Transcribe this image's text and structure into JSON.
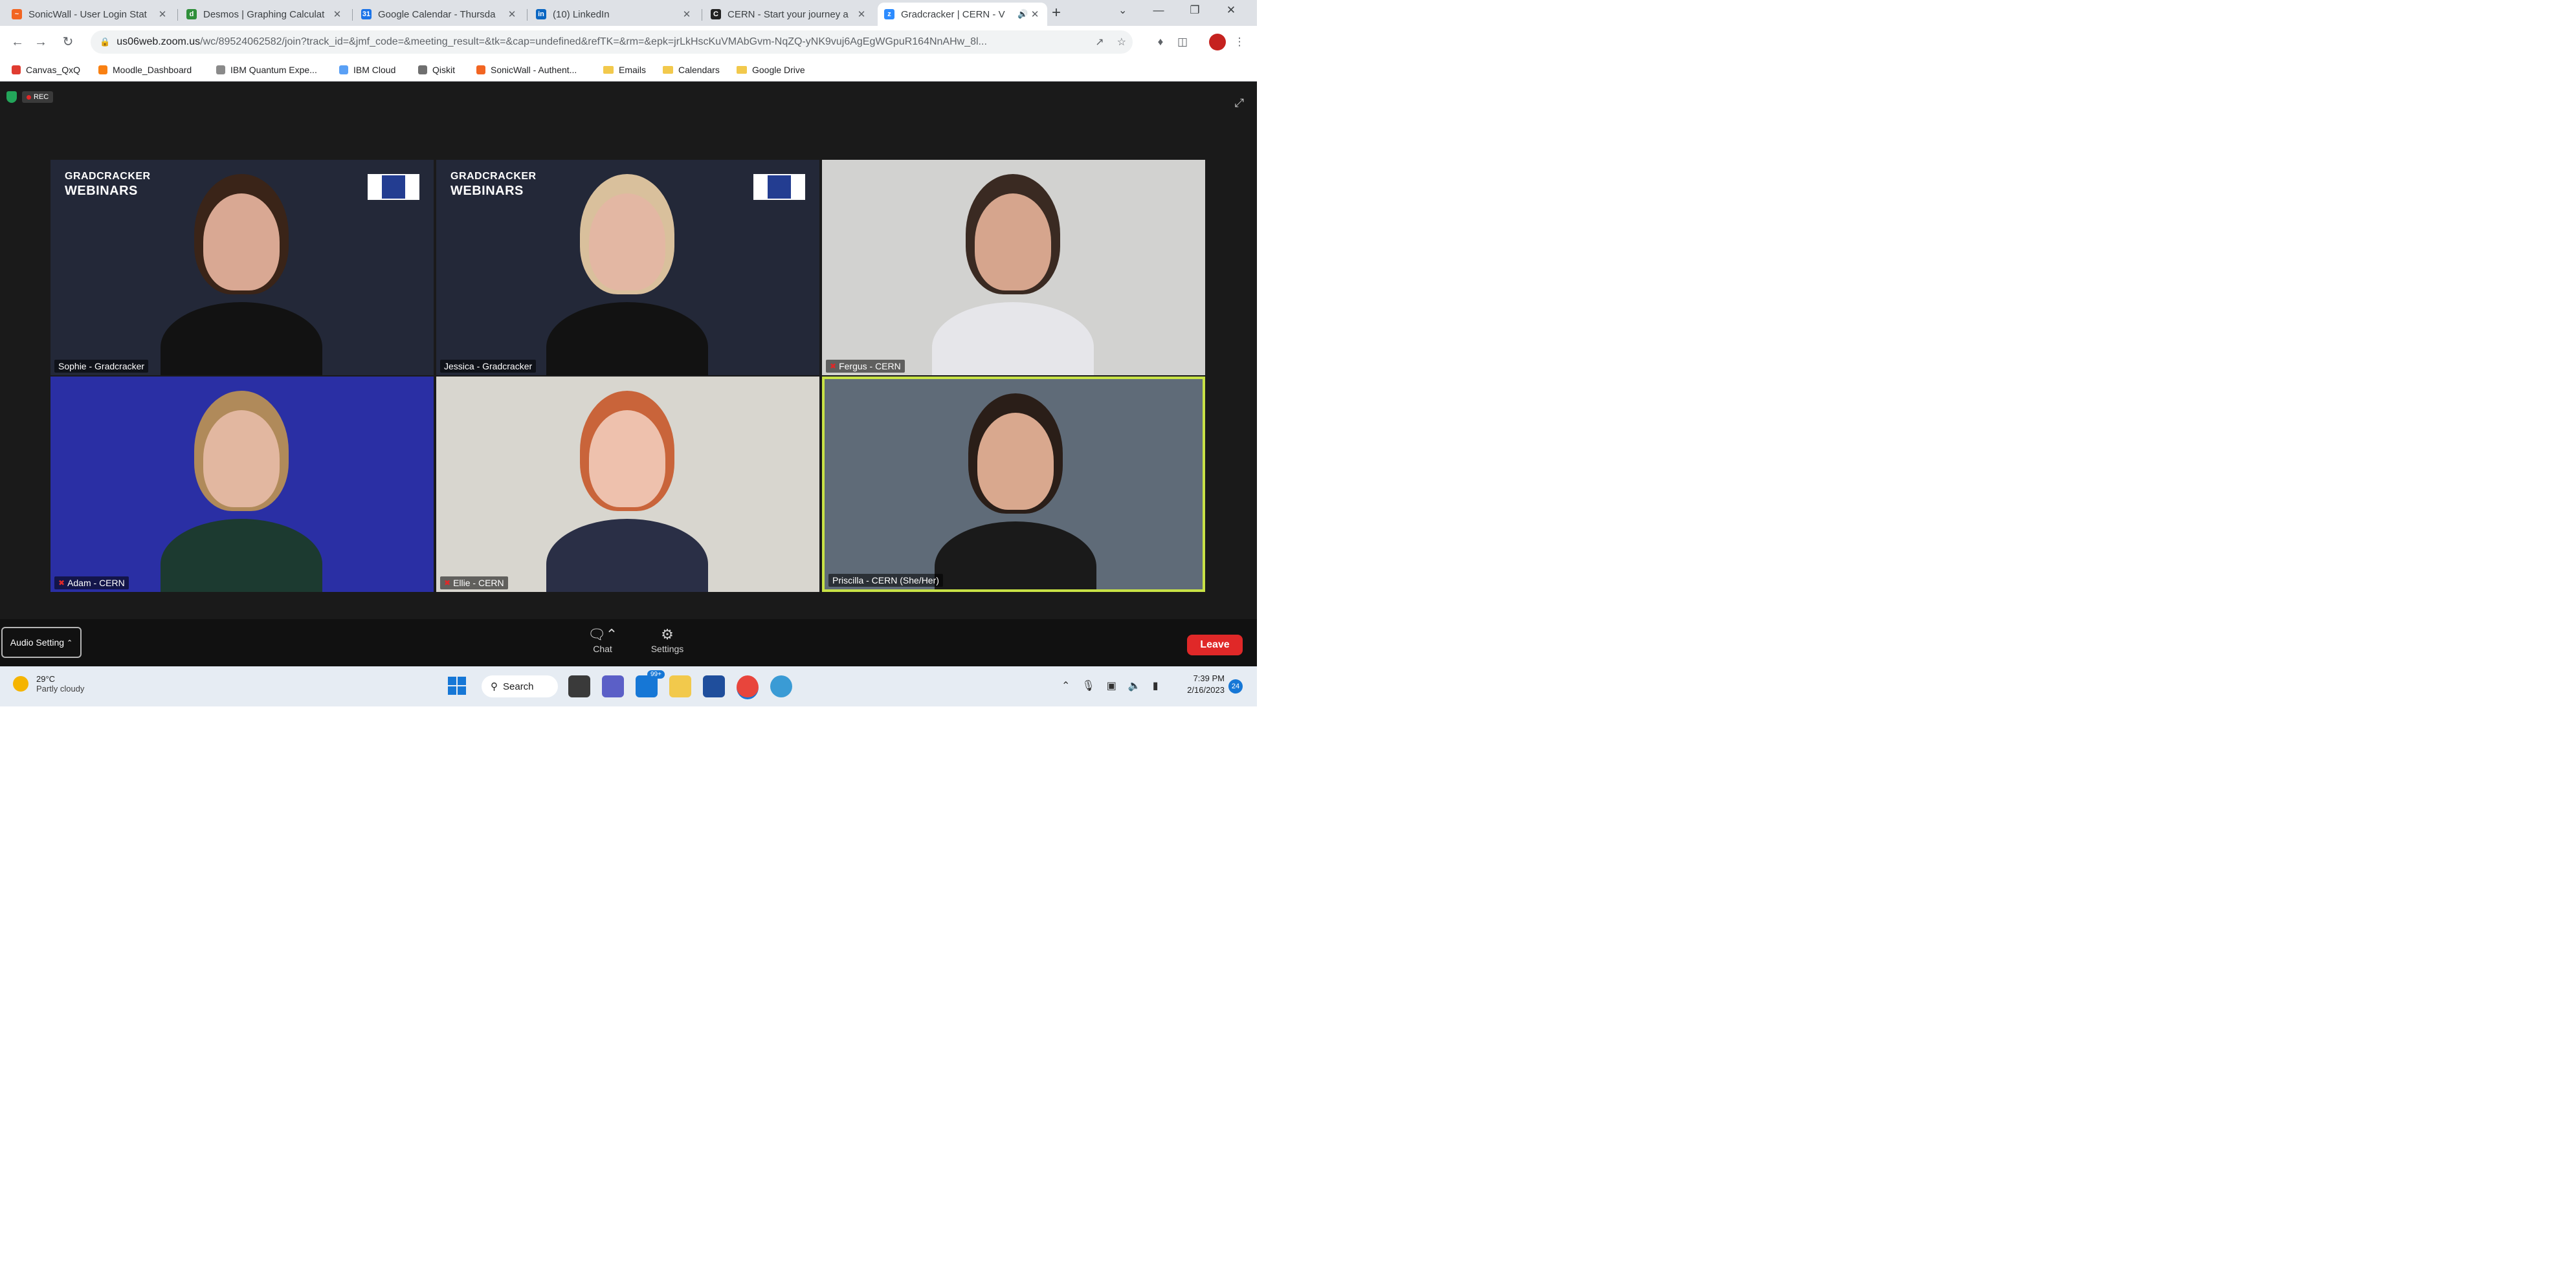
{
  "browser": {
    "tabs": [
      {
        "title": "SonicWall - User Login Stat",
        "favicon_color": "#f26522",
        "favicon_glyph": "~"
      },
      {
        "title": "Desmos | Graphing Calculat",
        "favicon_color": "#2f8f3a",
        "favicon_glyph": "d"
      },
      {
        "title": "Google Calendar - Thursda",
        "favicon_color": "#1a73e8",
        "favicon_glyph": "31"
      },
      {
        "title": "(10) LinkedIn",
        "favicon_color": "#0a66c2",
        "favicon_glyph": "in"
      },
      {
        "title": "CERN - Start your journey a",
        "favicon_color": "#222222",
        "favicon_glyph": "C"
      },
      {
        "title": "Gradcracker | CERN - V",
        "favicon_color": "#2d8cff",
        "favicon_glyph": "z",
        "active": true
      }
    ],
    "new_tab_label": "+",
    "url_host": "us06web.zoom.us",
    "url_rest": "/wc/89524062582/join?track_id=&jmf_code=&meeting_result=&tk=&cap=undefined&refTK=&rm=&epk=jrLkHscKuVMAbGvm-NqZQ-yNK9vuj6AgEgWGpuR164NnAHw_8l...",
    "bookmarks": [
      {
        "label": "Canvas_QxQ",
        "icon": "canvas-icon",
        "color": "#e03c31"
      },
      {
        "label": "Moodle_Dashboard",
        "icon": "moodle-icon",
        "color": "#f98012"
      },
      {
        "label": "IBM Quantum Expe...",
        "icon": "ibm-quantum-icon",
        "color": "#8a8a8a"
      },
      {
        "label": "IBM Cloud",
        "icon": "ibm-cloud-icon",
        "color": "#5aa0f5"
      },
      {
        "label": "Qiskit",
        "icon": "qiskit-icon",
        "color": "#6f6f6f"
      },
      {
        "label": "SonicWall - Authent...",
        "icon": "sonicwall-icon",
        "color": "#f26522"
      },
      {
        "label": "Emails",
        "icon": "folder-icon",
        "color": "#f2c94c"
      },
      {
        "label": "Calendars",
        "icon": "folder-icon",
        "color": "#f2c94c"
      },
      {
        "label": "Google Drive",
        "icon": "folder-icon",
        "color": "#f2c94c"
      }
    ]
  },
  "meeting": {
    "rec_label": "REC",
    "participants": [
      {
        "name": "Sophie - Gradcracker",
        "muted": false,
        "brand_line1": "GRADCRACKER",
        "brand_line2": "WEBINARS",
        "bg": "#232838",
        "skin": "#d9a893",
        "hair": "#3a2418",
        "shirt": "#121212"
      },
      {
        "name": "Jessica - Gradcracker",
        "muted": false,
        "brand_line1": "GRADCRACKER",
        "brand_line2": "WEBINARS",
        "bg": "#232838",
        "skin": "#e3b7a3",
        "hair": "#d9c09c",
        "shirt": "#121212"
      },
      {
        "name": "Fergus - CERN",
        "muted": true,
        "bg": "#d2d2d0",
        "skin": "#d6a58d",
        "hair": "#3a2a22",
        "shirt": "#e6e6ea"
      },
      {
        "name": "Adam - CERN",
        "muted": true,
        "bg": "#2a2fa4",
        "skin": "#e2b7a0",
        "hair": "#b08a5a",
        "shirt": "#1c3a30"
      },
      {
        "name": "Ellie - CERN",
        "muted": true,
        "bg": "#d8d6cf",
        "skin": "#eec1ad",
        "hair": "#c9643a",
        "shirt": "#2a2f46"
      },
      {
        "name": "Priscilla - CERN (She/Her)",
        "muted": false,
        "active": true,
        "bg": "#5f6b78",
        "skin": "#d9a88e",
        "hair": "#2a1e18",
        "shirt": "#1a1a1a"
      }
    ],
    "controls": {
      "audio_setting": "Audio Setting",
      "chat": "Chat",
      "settings": "Settings",
      "leave": "Leave"
    }
  },
  "taskbar": {
    "weather_temp": "29°C",
    "weather_desc": "Partly cloudy",
    "search_label": "Search",
    "mail_badge": "99+",
    "time": "7:39 PM",
    "date": "2/16/2023",
    "notification_count": "24"
  }
}
